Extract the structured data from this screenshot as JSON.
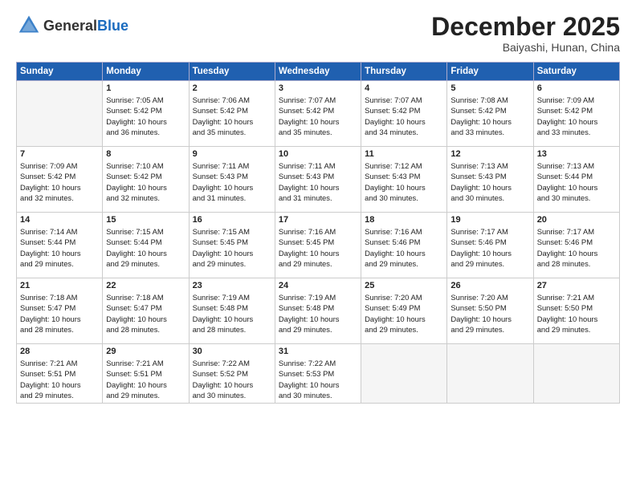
{
  "logo": {
    "general": "General",
    "blue": "Blue"
  },
  "title": "December 2025",
  "location": "Baiyashi, Hunan, China",
  "days_of_week": [
    "Sunday",
    "Monday",
    "Tuesday",
    "Wednesday",
    "Thursday",
    "Friday",
    "Saturday"
  ],
  "weeks": [
    [
      {
        "day": "",
        "empty": true
      },
      {
        "day": "1",
        "sunrise": "7:05 AM",
        "sunset": "5:42 PM",
        "daylight": "10 hours and 36 minutes."
      },
      {
        "day": "2",
        "sunrise": "7:06 AM",
        "sunset": "5:42 PM",
        "daylight": "10 hours and 35 minutes."
      },
      {
        "day": "3",
        "sunrise": "7:07 AM",
        "sunset": "5:42 PM",
        "daylight": "10 hours and 35 minutes."
      },
      {
        "day": "4",
        "sunrise": "7:07 AM",
        "sunset": "5:42 PM",
        "daylight": "10 hours and 34 minutes."
      },
      {
        "day": "5",
        "sunrise": "7:08 AM",
        "sunset": "5:42 PM",
        "daylight": "10 hours and 33 minutes."
      },
      {
        "day": "6",
        "sunrise": "7:09 AM",
        "sunset": "5:42 PM",
        "daylight": "10 hours and 33 minutes."
      }
    ],
    [
      {
        "day": "7",
        "sunrise": "7:09 AM",
        "sunset": "5:42 PM",
        "daylight": "10 hours and 32 minutes."
      },
      {
        "day": "8",
        "sunrise": "7:10 AM",
        "sunset": "5:42 PM",
        "daylight": "10 hours and 32 minutes."
      },
      {
        "day": "9",
        "sunrise": "7:11 AM",
        "sunset": "5:43 PM",
        "daylight": "10 hours and 31 minutes."
      },
      {
        "day": "10",
        "sunrise": "7:11 AM",
        "sunset": "5:43 PM",
        "daylight": "10 hours and 31 minutes."
      },
      {
        "day": "11",
        "sunrise": "7:12 AM",
        "sunset": "5:43 PM",
        "daylight": "10 hours and 30 minutes."
      },
      {
        "day": "12",
        "sunrise": "7:13 AM",
        "sunset": "5:43 PM",
        "daylight": "10 hours and 30 minutes."
      },
      {
        "day": "13",
        "sunrise": "7:13 AM",
        "sunset": "5:44 PM",
        "daylight": "10 hours and 30 minutes."
      }
    ],
    [
      {
        "day": "14",
        "sunrise": "7:14 AM",
        "sunset": "5:44 PM",
        "daylight": "10 hours and 29 minutes."
      },
      {
        "day": "15",
        "sunrise": "7:15 AM",
        "sunset": "5:44 PM",
        "daylight": "10 hours and 29 minutes."
      },
      {
        "day": "16",
        "sunrise": "7:15 AM",
        "sunset": "5:45 PM",
        "daylight": "10 hours and 29 minutes."
      },
      {
        "day": "17",
        "sunrise": "7:16 AM",
        "sunset": "5:45 PM",
        "daylight": "10 hours and 29 minutes."
      },
      {
        "day": "18",
        "sunrise": "7:16 AM",
        "sunset": "5:46 PM",
        "daylight": "10 hours and 29 minutes."
      },
      {
        "day": "19",
        "sunrise": "7:17 AM",
        "sunset": "5:46 PM",
        "daylight": "10 hours and 29 minutes."
      },
      {
        "day": "20",
        "sunrise": "7:17 AM",
        "sunset": "5:46 PM",
        "daylight": "10 hours and 28 minutes."
      }
    ],
    [
      {
        "day": "21",
        "sunrise": "7:18 AM",
        "sunset": "5:47 PM",
        "daylight": "10 hours and 28 minutes."
      },
      {
        "day": "22",
        "sunrise": "7:18 AM",
        "sunset": "5:47 PM",
        "daylight": "10 hours and 28 minutes."
      },
      {
        "day": "23",
        "sunrise": "7:19 AM",
        "sunset": "5:48 PM",
        "daylight": "10 hours and 28 minutes."
      },
      {
        "day": "24",
        "sunrise": "7:19 AM",
        "sunset": "5:48 PM",
        "daylight": "10 hours and 29 minutes."
      },
      {
        "day": "25",
        "sunrise": "7:20 AM",
        "sunset": "5:49 PM",
        "daylight": "10 hours and 29 minutes."
      },
      {
        "day": "26",
        "sunrise": "7:20 AM",
        "sunset": "5:50 PM",
        "daylight": "10 hours and 29 minutes."
      },
      {
        "day": "27",
        "sunrise": "7:21 AM",
        "sunset": "5:50 PM",
        "daylight": "10 hours and 29 minutes."
      }
    ],
    [
      {
        "day": "28",
        "sunrise": "7:21 AM",
        "sunset": "5:51 PM",
        "daylight": "10 hours and 29 minutes."
      },
      {
        "day": "29",
        "sunrise": "7:21 AM",
        "sunset": "5:51 PM",
        "daylight": "10 hours and 29 minutes."
      },
      {
        "day": "30",
        "sunrise": "7:22 AM",
        "sunset": "5:52 PM",
        "daylight": "10 hours and 30 minutes."
      },
      {
        "day": "31",
        "sunrise": "7:22 AM",
        "sunset": "5:53 PM",
        "daylight": "10 hours and 30 minutes."
      },
      {
        "day": "",
        "empty": true
      },
      {
        "day": "",
        "empty": true
      },
      {
        "day": "",
        "empty": true
      }
    ]
  ]
}
